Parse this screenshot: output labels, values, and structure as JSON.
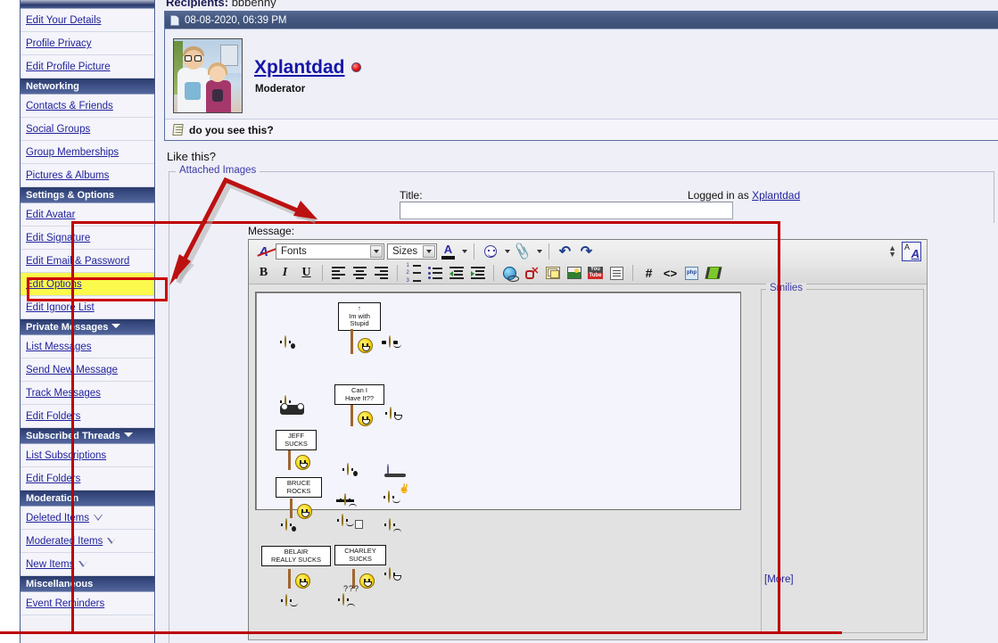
{
  "sidebar": {
    "sections": [
      {
        "type": "header-partial",
        "label": ""
      },
      {
        "type": "item",
        "label": "Edit Your Details"
      },
      {
        "type": "item",
        "label": "Profile Privacy"
      },
      {
        "type": "item",
        "label": "Edit Profile Picture"
      },
      {
        "type": "header",
        "label": "Networking",
        "caret": false
      },
      {
        "type": "item",
        "label": "Contacts & Friends"
      },
      {
        "type": "item",
        "label": "Social Groups"
      },
      {
        "type": "item",
        "label": "Group Memberships"
      },
      {
        "type": "item",
        "label": "Pictures & Albums"
      },
      {
        "type": "header",
        "label": "Settings & Options",
        "caret": false
      },
      {
        "type": "item",
        "label": "Edit Avatar"
      },
      {
        "type": "item",
        "label": "Edit Signature"
      },
      {
        "type": "item",
        "label": "Edit Email & Password"
      },
      {
        "type": "item",
        "label": "Edit Options",
        "highlight": true
      },
      {
        "type": "item",
        "label": "Edit Ignore List"
      },
      {
        "type": "header",
        "label": "Private Messages",
        "caret": true
      },
      {
        "type": "item",
        "label": "List Messages"
      },
      {
        "type": "item",
        "label": "Send New Message"
      },
      {
        "type": "item",
        "label": "Track Messages"
      },
      {
        "type": "item",
        "label": "Edit Folders"
      },
      {
        "type": "header",
        "label": "Subscribed Threads",
        "caret": true
      },
      {
        "type": "item",
        "label": "List Subscriptions"
      },
      {
        "type": "item",
        "label": "Edit Folders"
      },
      {
        "type": "header",
        "label": "Moderation",
        "caret": false
      },
      {
        "type": "item",
        "label": "Deleted Items",
        "caretOutline": true
      },
      {
        "type": "item",
        "label": "Moderated Items",
        "caretOutline": true
      },
      {
        "type": "item",
        "label": "New Items",
        "caretOutline": true
      },
      {
        "type": "header",
        "label": "Miscellaneous",
        "caret": false
      },
      {
        "type": "item",
        "label": "Event Reminders"
      }
    ]
  },
  "message": {
    "recipients_label": "Recipients",
    "recipients_value": "bbbenny",
    "timestamp": "08-08-2020, 06:39 PM",
    "username": "Xplantdad",
    "usertitle": "Moderator",
    "subject": "do you see this?",
    "body_text": "Like this?"
  },
  "reply_form": {
    "attached_images_legend": "Attached Images",
    "title_label": "Title:",
    "title_value": "",
    "title_placeholder": "",
    "logged_in_prefix": "Logged in as",
    "logged_in_user": "Xplantdad",
    "message_label": "Message:",
    "message_value": "",
    "smilies_legend": "Smilies",
    "more_link": "[More]"
  },
  "toolbar": {
    "row1": [
      {
        "name": "remove-formatting-icon",
        "label": ""
      },
      {
        "name": "font-family-select",
        "label": "Fonts"
      },
      {
        "name": "font-size-select",
        "label": "Sizes"
      },
      {
        "name": "font-color-icon",
        "label": "A"
      },
      {
        "name": "insert-smilie-icon",
        "label": ""
      },
      {
        "name": "attachment-icon",
        "label": ""
      },
      {
        "name": "undo-icon",
        "label": "↶"
      },
      {
        "name": "redo-icon",
        "label": "↷"
      }
    ],
    "row2": [
      {
        "name": "bold-icon",
        "label": "B"
      },
      {
        "name": "italic-icon",
        "label": "I"
      },
      {
        "name": "underline-icon",
        "label": "U"
      },
      {
        "name": "align-left-icon",
        "label": ""
      },
      {
        "name": "align-center-icon",
        "label": ""
      },
      {
        "name": "align-right-icon",
        "label": ""
      },
      {
        "name": "ordered-list-icon",
        "label": ""
      },
      {
        "name": "unordered-list-icon",
        "label": ""
      },
      {
        "name": "outdent-icon",
        "label": ""
      },
      {
        "name": "indent-icon",
        "label": ""
      },
      {
        "name": "insert-link-icon",
        "label": ""
      },
      {
        "name": "remove-link-icon",
        "label": ""
      },
      {
        "name": "insert-email-icon",
        "label": ""
      },
      {
        "name": "insert-image-icon",
        "label": ""
      },
      {
        "name": "insert-video-icon",
        "label": "You"
      },
      {
        "name": "wrap-quote-icon",
        "label": ""
      },
      {
        "name": "insert-hash-icon",
        "label": "#"
      },
      {
        "name": "insert-code-icon",
        "label": "<>"
      },
      {
        "name": "insert-php-icon",
        "label": "php"
      },
      {
        "name": "insert-highlight-icon",
        "label": ""
      }
    ],
    "toggle_editor_label": "A",
    "resize_label": "⇕"
  },
  "smilies": {
    "signs": [
      {
        "text": "↑\nIm with\nStupid"
      },
      {
        "text": "Can I\nHave It??"
      },
      {
        "text": "JEFF\nSUCKS"
      },
      {
        "text": "BRUCE\nROCKS"
      },
      {
        "text": "BELAIR\nREALLY SUCKS"
      },
      {
        "text": "CHARLEY\nSUCKS"
      }
    ],
    "question_marks": "???"
  },
  "colors": {
    "accent_navy": "#3C4F86",
    "link_blue": "#22229C",
    "annotation_red": "#BC0000",
    "highlight_yellow": "#FBF94B",
    "username_blue": "#1616A8",
    "page_bg": "#EFEFF7",
    "toolbar_grey": "#E6E6E6"
  }
}
